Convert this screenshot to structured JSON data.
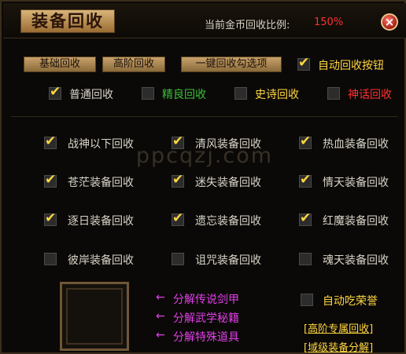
{
  "window": {
    "title": "装备回收",
    "ratio_label": "当前金币回收比例:",
    "ratio_value": "150%",
    "close_glyph": "×"
  },
  "toolbar": {
    "basic_label": "基础回收",
    "advanced_label": "高阶回收",
    "one_click_label": "一键回收勾选项",
    "auto_button_label": "自动回收按钮",
    "auto_button_checked": true
  },
  "grades": [
    {
      "label": "普通回收",
      "checked": true,
      "color": "#d8d4c8"
    },
    {
      "label": "精良回收",
      "checked": false,
      "color": "#3ac03a"
    },
    {
      "label": "史诗回收",
      "checked": false,
      "color": "#ffd640"
    },
    {
      "label": "神话回收",
      "checked": false,
      "color": "#ff3030"
    }
  ],
  "equipment": [
    {
      "label": "战神以下回收",
      "checked": true
    },
    {
      "label": "清风装备回收",
      "checked": true
    },
    {
      "label": "热血装备回收",
      "checked": true
    },
    {
      "label": "苍茫装备回收",
      "checked": true
    },
    {
      "label": "迷失装备回收",
      "checked": true
    },
    {
      "label": "情天装备回收",
      "checked": true
    },
    {
      "label": "逐日装备回收",
      "checked": true
    },
    {
      "label": "遗忘装备回收",
      "checked": true
    },
    {
      "label": "红魔装备回收",
      "checked": true
    },
    {
      "label": "彼岸装备回收",
      "checked": false
    },
    {
      "label": "诅咒装备回收",
      "checked": false
    },
    {
      "label": "魂天装备回收",
      "checked": false
    }
  ],
  "decompose": {
    "arrow": "←",
    "items": [
      "分解传说剑甲",
      "分解武学秘籍",
      "分解特殊道具"
    ]
  },
  "auto_honor": {
    "label": "自动吃荣誉",
    "checked": false
  },
  "links": {
    "advanced_recycle": "[高阶专属回收]",
    "domain_decompose": "[域级装备分解]"
  },
  "watermark": "ppcqzj.com"
}
